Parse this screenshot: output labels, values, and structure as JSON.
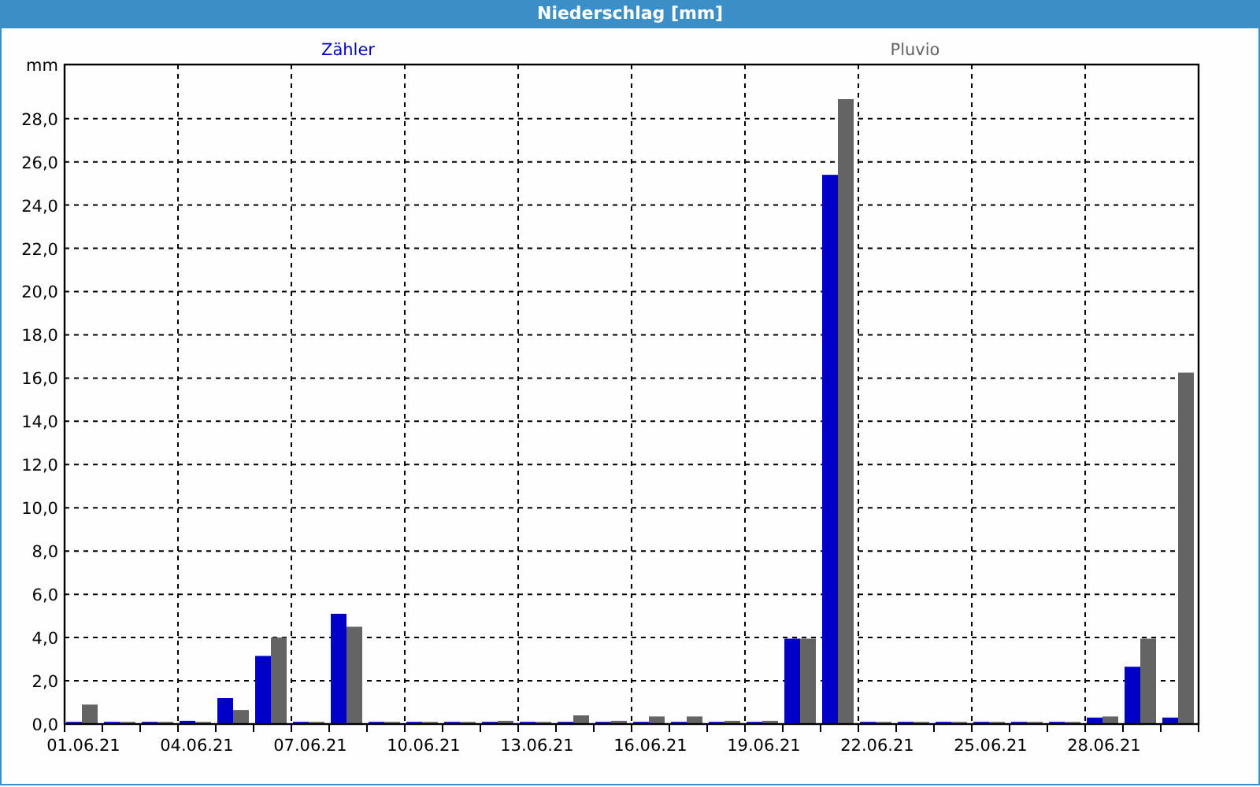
{
  "window": {
    "title": "Niederschlag [mm]"
  },
  "chart_data": {
    "type": "bar",
    "ylabel": "mm",
    "ylim": [
      0,
      30.5
    ],
    "yticks": [
      {
        "value": 0,
        "label": "0,0"
      },
      {
        "value": 2,
        "label": "2,0"
      },
      {
        "value": 4,
        "label": "4,0"
      },
      {
        "value": 6,
        "label": "6,0"
      },
      {
        "value": 8,
        "label": "8,0"
      },
      {
        "value": 10,
        "label": "10,0"
      },
      {
        "value": 12,
        "label": "12,0"
      },
      {
        "value": 14,
        "label": "14,0"
      },
      {
        "value": 16,
        "label": "16,0"
      },
      {
        "value": 18,
        "label": "18,0"
      },
      {
        "value": 20,
        "label": "20,0"
      },
      {
        "value": 22,
        "label": "22,0"
      },
      {
        "value": 24,
        "label": "24,0"
      },
      {
        "value": 26,
        "label": "26,0"
      },
      {
        "value": 28,
        "label": "28,0"
      }
    ],
    "grid": true,
    "categories": [
      "01.06.21",
      null,
      null,
      "04.06.21",
      null,
      null,
      "07.06.21",
      null,
      null,
      "10.06.21",
      null,
      null,
      "13.06.21",
      null,
      null,
      "16.06.21",
      null,
      null,
      "19.06.21",
      null,
      null,
      "22.06.21",
      null,
      null,
      "25.06.21",
      null,
      null,
      "28.06.21",
      null,
      null
    ],
    "series": [
      {
        "name": "Zähler",
        "color": "#0000c8",
        "values": [
          0.1,
          0.1,
          0.1,
          0.15,
          1.2,
          3.15,
          0.1,
          5.1,
          0.1,
          0.1,
          0.1,
          0.1,
          0.1,
          0.1,
          0.1,
          0.1,
          0.1,
          0.1,
          0.1,
          3.95,
          25.4,
          0.1,
          0.1,
          0.1,
          0.1,
          0.1,
          0.1,
          0.3,
          2.65,
          0.3
        ]
      },
      {
        "name": "Pluvio",
        "color": "#646464",
        "values": [
          0.9,
          0.1,
          0.1,
          0.1,
          0.65,
          4.0,
          0.1,
          4.5,
          0.1,
          0.1,
          0.1,
          0.15,
          0.1,
          0.4,
          0.15,
          0.35,
          0.35,
          0.15,
          0.15,
          3.95,
          28.9,
          0.1,
          0.1,
          0.1,
          0.1,
          0.1,
          0.1,
          0.35,
          3.95,
          16.25
        ]
      }
    ]
  }
}
